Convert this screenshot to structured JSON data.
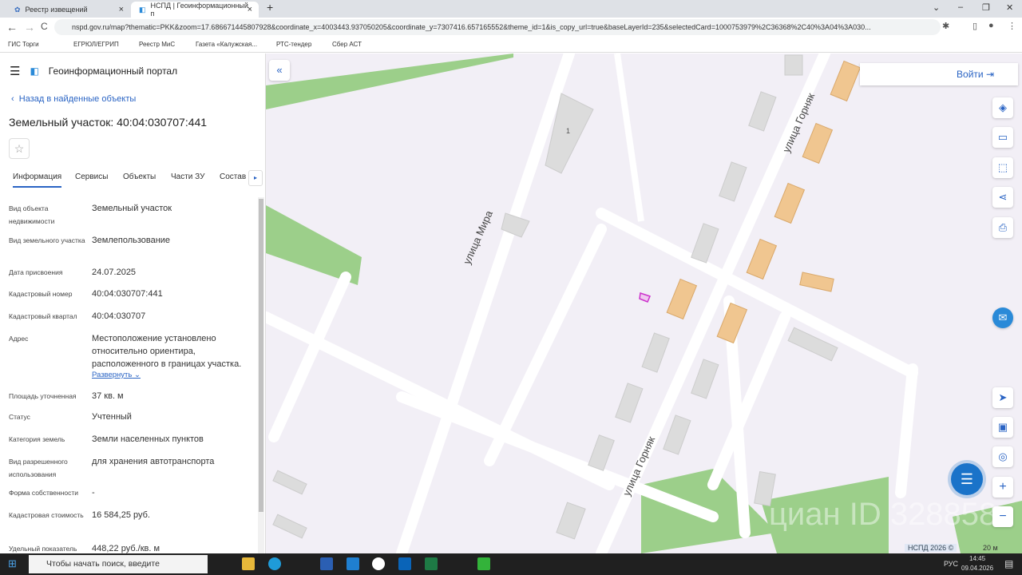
{
  "browser": {
    "tabs": [
      {
        "label": "Реестр извещений"
      },
      {
        "label": "НСПД | Геоинформационный п",
        "active": true
      }
    ],
    "url": "nspd.gov.ru/map?thematic=PKK&zoom=17.686671445807928&coordinate_x=4003443.937050205&coordinate_y=7307416.657165552&theme_id=1&is_copy_url=true&baseLayerId=235&selectedCard=1000753979%2C36368%2C40%3A04%3A030...",
    "bookmarks": [
      "ГИС Торги",
      "ЕГРЮЛ/ЕГРИП",
      "Реестр МиС",
      "Газета «Калужская...",
      "РТС-тендер",
      "Сбер АСТ"
    ]
  },
  "header": {
    "title": "Геоинформационный портал"
  },
  "panel": {
    "back_label": "Назад в найденные объекты",
    "title": "Земельный участок: 40:04:030707:441",
    "tabs": [
      "Информация",
      "Сервисы",
      "Объекты",
      "Части ЗУ",
      "Состав"
    ],
    "expand_label": "Развернуть",
    "fields": [
      {
        "label": "Вид объекта недвижимости",
        "value": "Земельный участок"
      },
      {
        "label": "Вид земельного участка",
        "value": "Землепользование"
      },
      {
        "label": "Дата присвоения",
        "value": "24.07.2025"
      },
      {
        "label": "Кадастровый номер",
        "value": "40:04:030707:441"
      },
      {
        "label": "Кадастровый квартал",
        "value": "40:04:030707"
      },
      {
        "label": "Адрес",
        "value": "Местоположение установлено относительно ориентира, расположенного в границах участка."
      },
      {
        "label": "Площадь уточненная",
        "value": "37 кв. м"
      },
      {
        "label": "Статус",
        "value": "Учтенный"
      },
      {
        "label": "Категория земель",
        "value": "Земли населенных пунктов"
      },
      {
        "label": "Вид разрешенного использования",
        "value": "для хранения автотранспорта"
      },
      {
        "label": "Форма собственности",
        "value": "-"
      },
      {
        "label": "Кадастровая стоимость",
        "value": "16 584,25 руб."
      },
      {
        "label": "Удельный показатель",
        "value": "448,22 руб./кв. м"
      }
    ]
  },
  "map": {
    "login_label": "Войти",
    "streets": [
      "улица Мира",
      "улица Горняк",
      "улица Горняк"
    ],
    "building_number": "1",
    "attribution": "НСПД 2026 ©",
    "scale": "20 м",
    "watermark": "циан ID 328858",
    "colors": {
      "background": "#f2eff6",
      "green": "#9ccf8a",
      "building": "#dcdcdc",
      "garage": "#f0c690",
      "selected": "#cc33cc"
    }
  },
  "taskbar": {
    "search_placeholder": "Чтобы начать поиск, введите",
    "lang": "РУС",
    "time": "14:45",
    "date": "09.04.2026"
  }
}
